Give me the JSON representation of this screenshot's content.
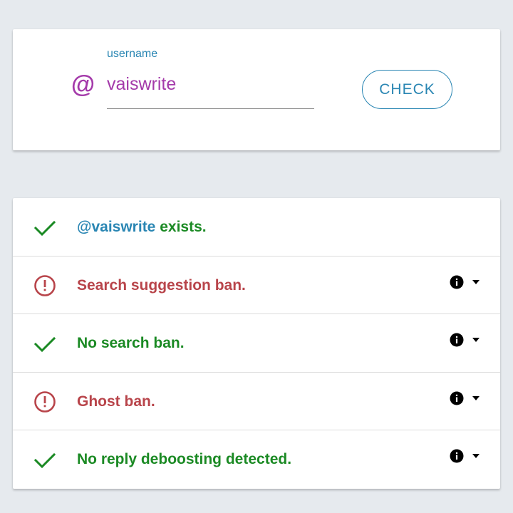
{
  "search": {
    "at_symbol": "@",
    "label": "username",
    "value": "vaiswrite",
    "button_label": "CHECK"
  },
  "results": [
    {
      "user_text": "@vaiswrite",
      "text": " exists.",
      "status": "ok",
      "has_info": false
    },
    {
      "text": "Search suggestion ban.",
      "status": "bad",
      "has_info": true
    },
    {
      "text": "No search ban.",
      "status": "ok",
      "has_info": true
    },
    {
      "text": "Ghost ban.",
      "status": "bad",
      "has_info": true
    },
    {
      "text": "No reply deboosting detected.",
      "status": "ok",
      "has_info": true
    }
  ],
  "icons": {
    "ok": "check-icon",
    "bad": "alert-circle-icon",
    "info": "info-icon",
    "caret": "caret-down-icon"
  },
  "colors": {
    "background": "#e6eaee",
    "accent_blue": "#2a86b3",
    "username_purple": "#a43aaa",
    "ok_green": "#1b8a24",
    "bad_red": "#b8444a"
  }
}
